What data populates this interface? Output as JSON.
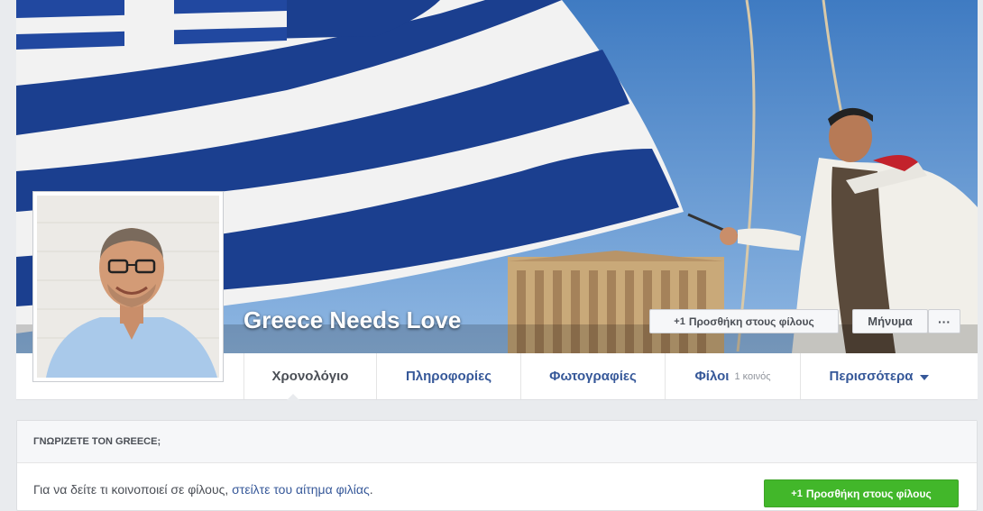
{
  "profile": {
    "name": "Greece Needs Love"
  },
  "cover_actions": {
    "add_friend": "Προσθήκη στους φίλους",
    "message": "Μήνυμα",
    "more": "···"
  },
  "tabs": [
    {
      "label": "Χρονολόγιο"
    },
    {
      "label": "Πληροφορίες"
    },
    {
      "label": "Φωτογραφίες"
    },
    {
      "label": "Φίλοι",
      "sub": "1 κοινός"
    },
    {
      "label": "Περισσότερα"
    }
  ],
  "card": {
    "header": "ΓΝΩΡΙΖΕΤΕ ΤΟΝ GREECE;",
    "text_prefix": "Για να δείτε τι κοινοποιεί σε φίλους, ",
    "link": "στείλτε του αίτημα φιλίας",
    "text_suffix": ".",
    "button": "Προσθήκη στους φίλους"
  },
  "icons": {
    "add_friend": "add-friend-icon",
    "dropdown": "caret-down-icon"
  },
  "colors": {
    "link": "#365899",
    "green_button": "#42b72a",
    "page_bg": "#e9ebee"
  }
}
